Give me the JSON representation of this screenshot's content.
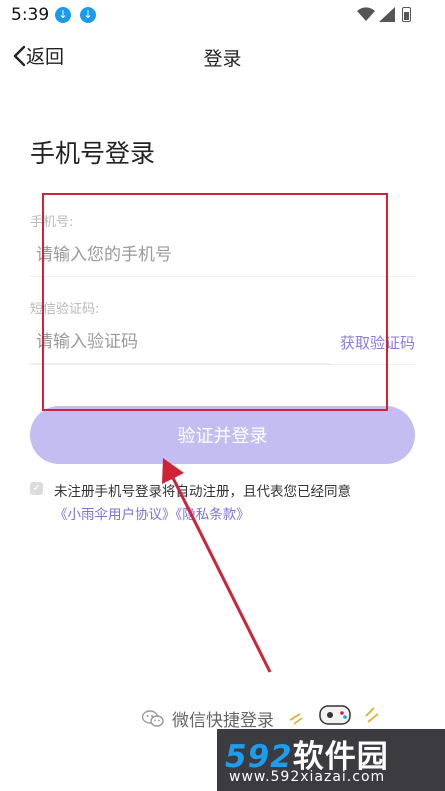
{
  "status": {
    "time": "5:39"
  },
  "nav": {
    "back_label": "返回",
    "title": "登录"
  },
  "heading": "手机号登录",
  "phone": {
    "label": "手机号:",
    "placeholder": "请输入您的手机号"
  },
  "code": {
    "label": "短信验证码:",
    "placeholder": "请输入验证码",
    "get_code_label": "获取验证码"
  },
  "login_button_label": "验证并登录",
  "agreement": {
    "text": "未注册手机号登录将自动注册，且代表您已经同意",
    "user_agreement": "《小雨伞用户协议》",
    "privacy_policy": "《隐私条款》"
  },
  "wechat_login_label": "微信快捷登录",
  "watermark": {
    "brand_number": "592",
    "brand_text": "软件园",
    "url": "www.592xiazai.com"
  },
  "colors": {
    "accent": "#8a7cd8",
    "button_bg": "#c4bdf1",
    "annotation_red": "#d02338",
    "download_blue": "#1a9bf0"
  }
}
